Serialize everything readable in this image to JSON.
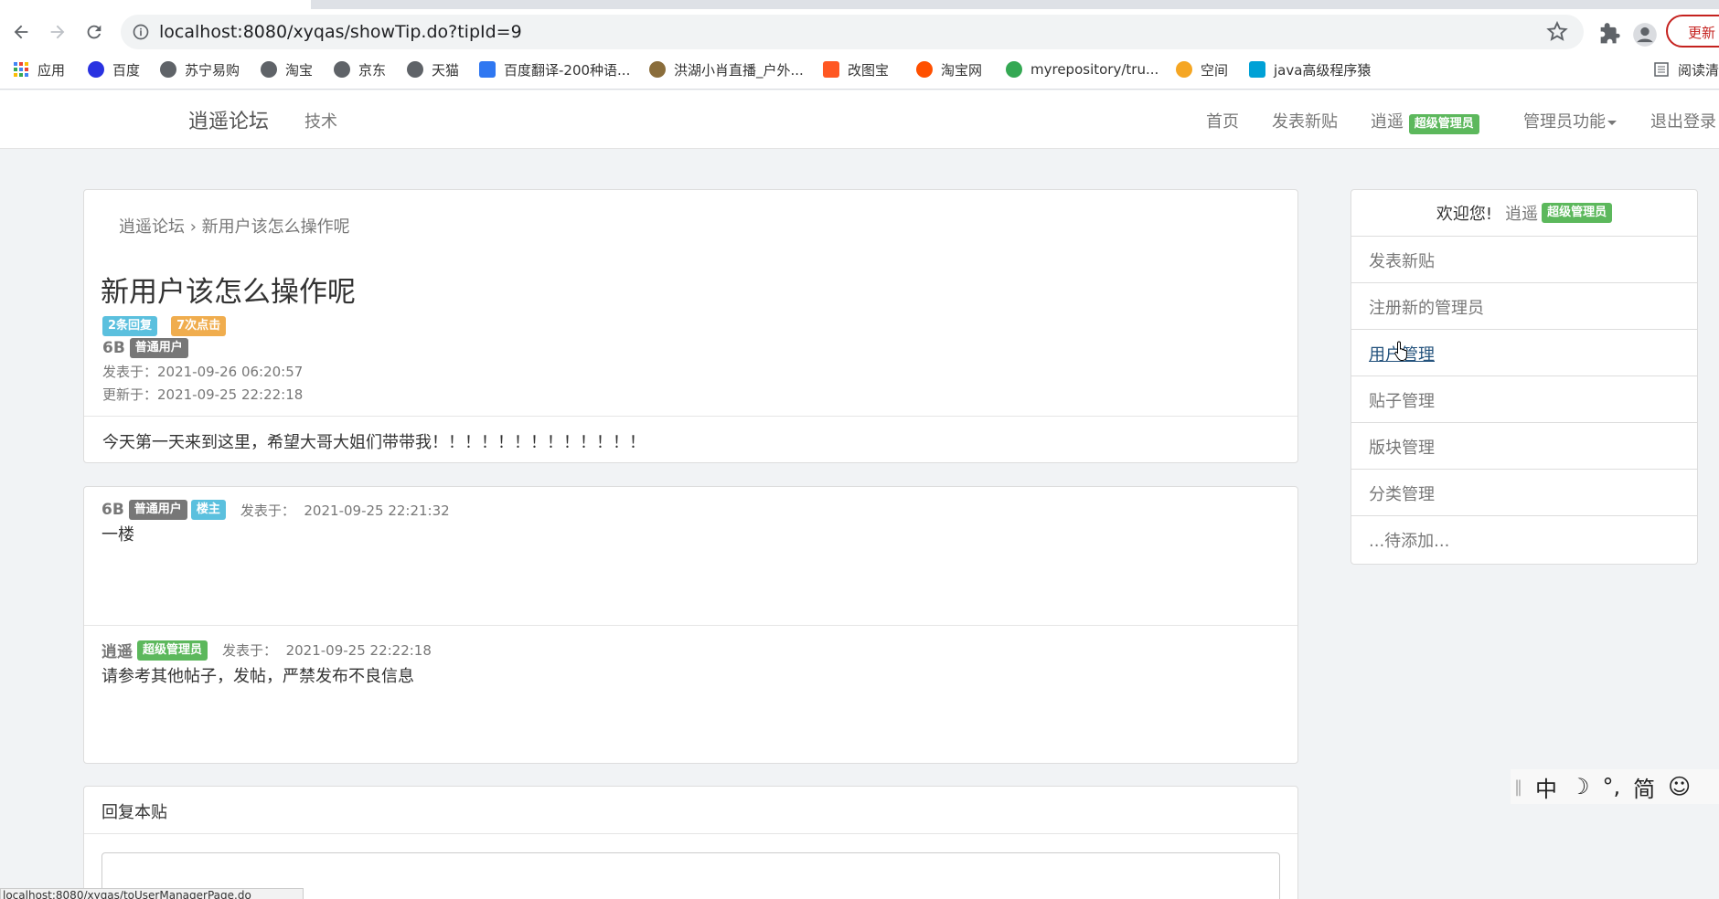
{
  "browser": {
    "url": "localhost:8080/xyqas/showTip.do?tipId=9",
    "update_label": "更新",
    "bookmarks": [
      {
        "label": "应用",
        "icon": "apps-grid-icon",
        "color": "#4285f4"
      },
      {
        "label": "百度",
        "icon": "baidu-paw-icon",
        "color": "#2932e1"
      },
      {
        "label": "苏宁易购",
        "icon": "globe-icon",
        "color": "#5f6368"
      },
      {
        "label": "淘宝",
        "icon": "globe-icon",
        "color": "#5f6368"
      },
      {
        "label": "京东",
        "icon": "globe-icon",
        "color": "#5f6368"
      },
      {
        "label": "天猫",
        "icon": "globe-icon",
        "color": "#5f6368"
      },
      {
        "label": "百度翻译-200种语...",
        "icon": "translate-icon",
        "color": "#2f77f1"
      },
      {
        "label": "洪湖小肖直播_户外...",
        "icon": "bee-icon",
        "color": "#8a6d3b"
      },
      {
        "label": "改图宝",
        "icon": "gaitubao-icon",
        "color": "#ff5722"
      },
      {
        "label": "淘宝网",
        "icon": "taobao-icon",
        "color": "#ff5000"
      },
      {
        "label": "myrepository/tru...",
        "icon": "chrome-icon",
        "color": "#34a853"
      },
      {
        "label": "空间",
        "icon": "qzone-icon",
        "color": "#f5a623"
      },
      {
        "label": "java高级程序猿",
        "icon": "bilibili-icon",
        "color": "#00a1d6"
      }
    ],
    "reader_label": "阅读清",
    "status_text": "localhost:8080/xyqas/toUserManagerPage.do"
  },
  "nav": {
    "brand": "逍遥论坛",
    "tech": "技术",
    "home": "首页",
    "new_post": "发表新贴",
    "user": "逍遥",
    "role": "超级管理员",
    "admin": "管理员功能",
    "logout": "退出登录"
  },
  "post": {
    "breadcrumb_home": "逍遥论坛",
    "breadcrumb_sep": "›",
    "breadcrumb_current": "新用户该怎么操作呢",
    "title": "新用户该怎么操作呢",
    "replies_badge": "2条回复",
    "clicks_badge": "7次点击",
    "author": "6B",
    "author_role": "普通用户",
    "posted": "发表于：2021-09-26 06:20:57",
    "updated": "更新于：2021-09-25 22:22:18",
    "body": "今天第一天来到这里，希望大哥大姐们带带我！！！！！！！！！！！！！"
  },
  "replies": [
    {
      "author": "6B",
      "role": "普通用户",
      "tag": "楼主",
      "time_label": "发表于：",
      "time": "2021-09-25 22:21:32",
      "text": "一楼"
    },
    {
      "author": "逍遥",
      "role": "超级管理员",
      "tag": "",
      "time_label": "发表于：",
      "time": "2021-09-25 22:22:18",
      "text": "请参考其他帖子，发帖，严禁发布不良信息"
    }
  ],
  "reply_box": {
    "title": "回复本贴"
  },
  "sidebar": {
    "welcome": "欢迎您!",
    "user": "逍遥",
    "role": "超级管理员",
    "items": [
      "发表新贴",
      "注册新的管理员",
      "用户管理",
      "贴子管理",
      "版块管理",
      "分类管理",
      "...待添加..."
    ]
  },
  "ime": {
    "items": [
      "中",
      "☽",
      "°,",
      "简",
      "☺"
    ]
  },
  "colors": {
    "success": "#5cb85c",
    "info": "#5bc0de",
    "warning": "#f0ad4e",
    "default": "#777777",
    "link_hover": "#23527c"
  }
}
